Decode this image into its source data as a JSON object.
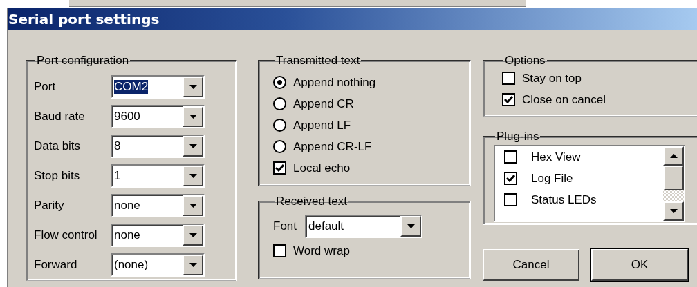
{
  "window": {
    "title": "Serial port settings"
  },
  "port_configuration": {
    "title": "Port configuration",
    "fields": [
      {
        "label": "Port",
        "value": "COM2",
        "highlighted": true
      },
      {
        "label": "Baud rate",
        "value": "9600",
        "highlighted": false
      },
      {
        "label": "Data bits",
        "value": "8",
        "highlighted": false
      },
      {
        "label": "Stop bits",
        "value": "1",
        "highlighted": false
      },
      {
        "label": "Parity",
        "value": "none",
        "highlighted": false
      },
      {
        "label": "Flow control",
        "value": "none",
        "highlighted": false
      },
      {
        "label": "Forward",
        "value": "(none)",
        "highlighted": false
      }
    ]
  },
  "transmitted_text": {
    "title": "Transmitted text",
    "options": [
      {
        "label": "Append nothing",
        "selected": true
      },
      {
        "label": "Append CR",
        "selected": false
      },
      {
        "label": "Append LF",
        "selected": false
      },
      {
        "label": "Append CR-LF",
        "selected": false
      }
    ],
    "local_echo": {
      "label": "Local echo",
      "checked": true
    }
  },
  "received_text": {
    "title": "Received text",
    "font": {
      "label": "Font",
      "value": "default"
    },
    "word_wrap": {
      "label": "Word wrap",
      "checked": false
    }
  },
  "options": {
    "title": "Options",
    "items": [
      {
        "label": "Stay on top",
        "checked": false
      },
      {
        "label": "Close on cancel",
        "checked": true
      }
    ]
  },
  "plugins": {
    "title": "Plug-ins",
    "items": [
      {
        "label": "Hex View",
        "checked": false
      },
      {
        "label": "Log File",
        "checked": true
      },
      {
        "label": "Status LEDs",
        "checked": false
      }
    ]
  },
  "buttons": [
    {
      "label": "Cancel",
      "default": false
    },
    {
      "label": "OK",
      "default": true
    }
  ]
}
